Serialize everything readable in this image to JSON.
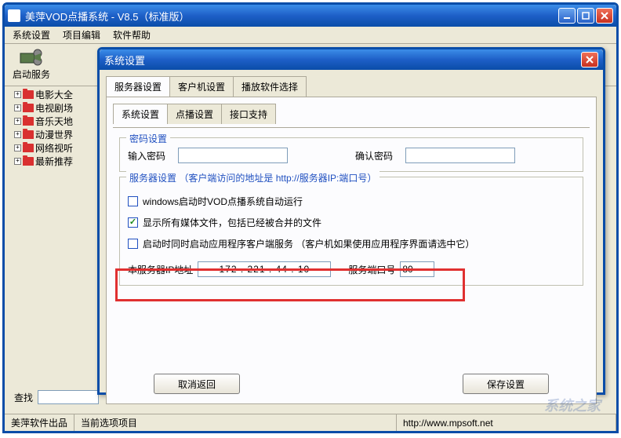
{
  "window": {
    "title": "美萍VOD点播系统 - V8.5（标准版）"
  },
  "menubar": {
    "system_settings": "系统设置",
    "project_edit": "项目编辑",
    "software_help": "软件帮助"
  },
  "toolbar": {
    "start_service": "启动服务"
  },
  "tree": {
    "items": [
      {
        "label": "电影大全"
      },
      {
        "label": "电视剧场"
      },
      {
        "label": "音乐天地"
      },
      {
        "label": "动漫世界"
      },
      {
        "label": "网络视听"
      },
      {
        "label": "最新推荐"
      }
    ]
  },
  "search": {
    "label": "查找",
    "value": ""
  },
  "statusbar": {
    "vendor": "美萍软件出品",
    "current_item_label": "当前选项项目",
    "url": "http://www.mpsoft.net"
  },
  "dialog": {
    "title": "系统设置",
    "tabs": {
      "server_settings": "服务器设置",
      "client_settings": "客户机设置",
      "player_select": "播放软件选择"
    },
    "subtabs": {
      "system_settings": "系统设置",
      "vod_settings": "点播设置",
      "interface_support": "接口支持"
    },
    "password_group": {
      "legend": "密码设置",
      "input_pwd_label": "输入密码",
      "confirm_pwd_label": "确认密码",
      "input_pwd_value": "",
      "confirm_pwd_value": ""
    },
    "server_group": {
      "legend": "服务器设置",
      "hint": "（客户端访问的地址是 http://服务器IP:端口号）",
      "chk_autostart": "windows启动时VOD点播系统自动运行",
      "chk_autostart_checked": false,
      "chk_showall": "显示所有媒体文件，包括已经被合并的文件",
      "chk_showall_checked": true,
      "chk_clientservice": "启动时同时启动应用程序客户端服务 （客户机如果使用应用程序界面请选中它）",
      "chk_clientservice_checked": false,
      "ip_label": "本服务器IP地址",
      "ip_value": "172 . 221 .  44 .  10",
      "port_label": "服务端口号",
      "port_value": "80"
    },
    "buttons": {
      "cancel": "取消返回",
      "save": "保存设置"
    }
  },
  "watermark": "系统之家"
}
